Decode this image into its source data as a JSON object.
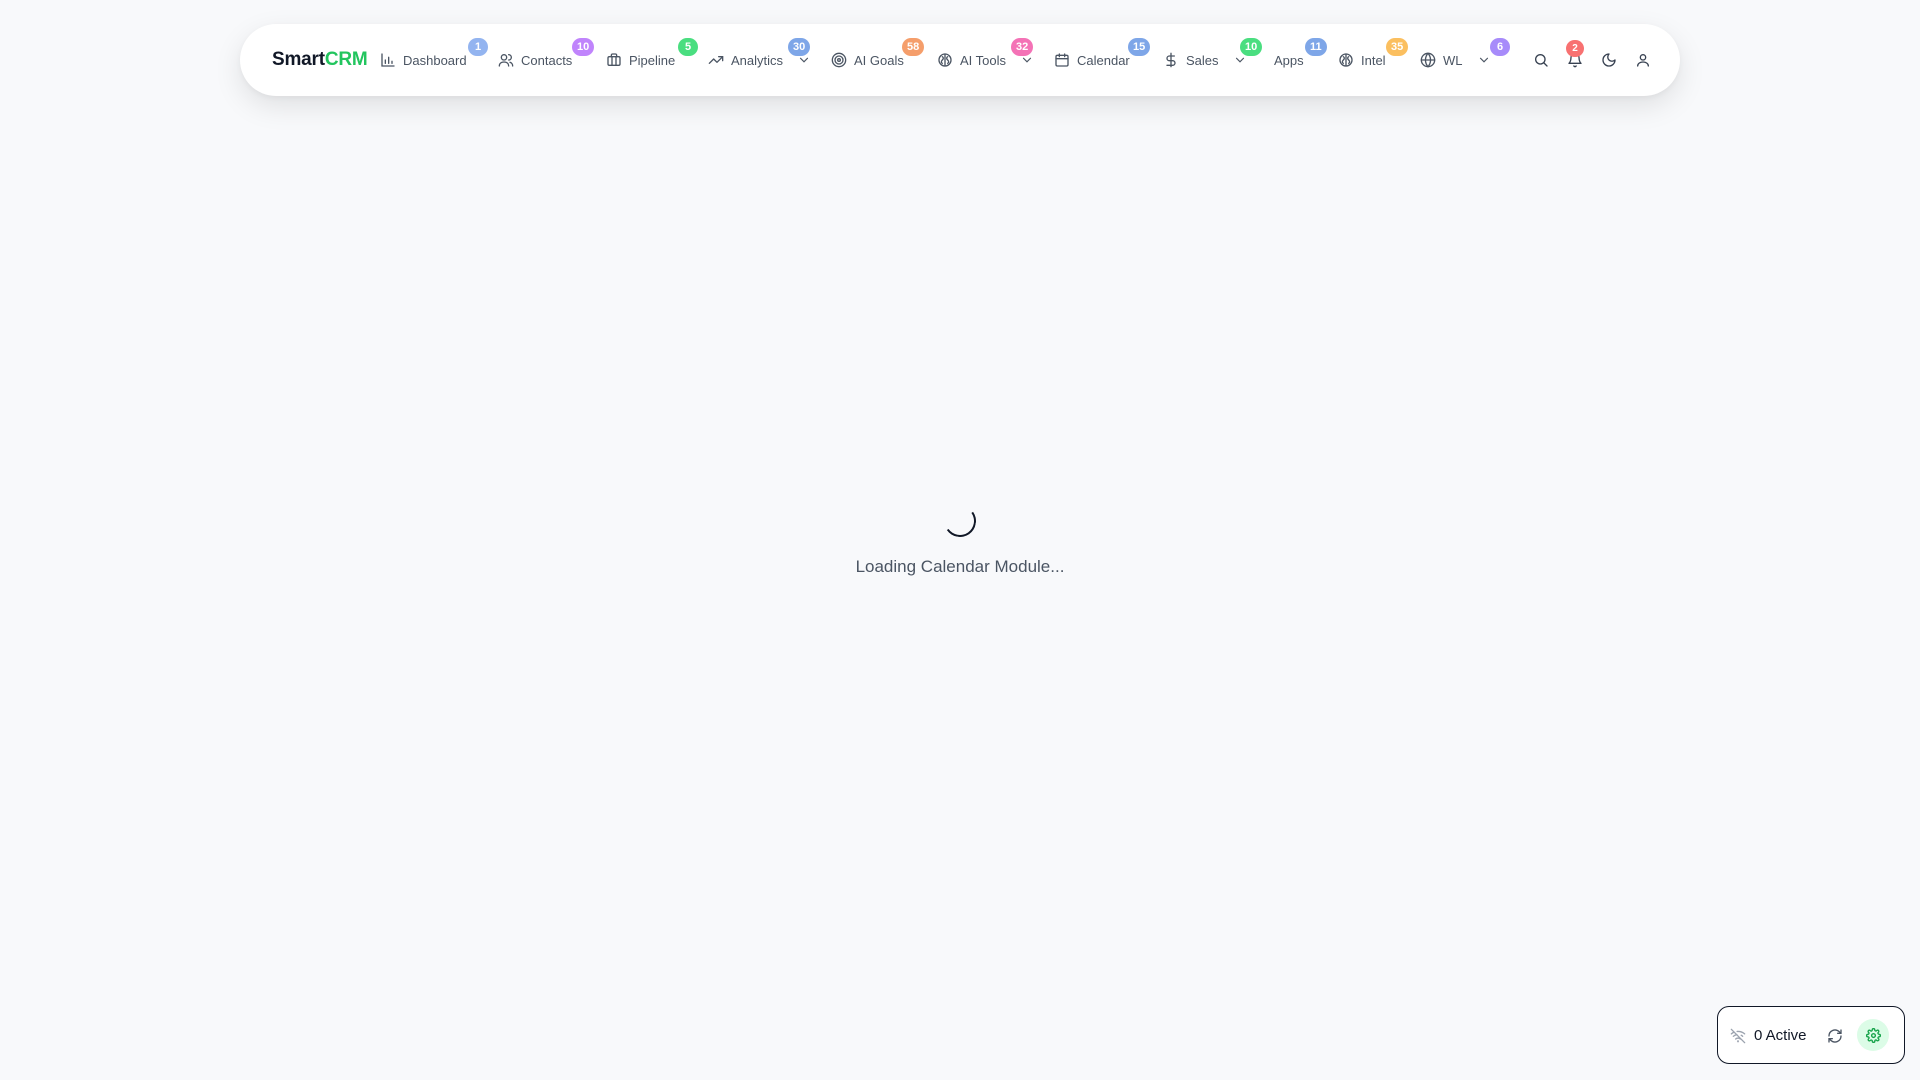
{
  "brand": {
    "part1": "Smart",
    "part2": "CRM",
    "accent": "#22c55e"
  },
  "nav": [
    {
      "id": "dashboard",
      "label": "Dashboard",
      "icon": "bar-chart-icon",
      "badge": "1",
      "badge_color": "#93b4f0",
      "dropdown": false
    },
    {
      "id": "contacts",
      "label": "Contacts",
      "icon": "users-icon",
      "badge": "10",
      "badge_color": "#c084fc",
      "dropdown": false
    },
    {
      "id": "pipeline",
      "label": "Pipeline",
      "icon": "briefcase-icon",
      "badge": "5",
      "badge_color": "#4ade80",
      "dropdown": false
    },
    {
      "id": "analytics",
      "label": "Analytics",
      "icon": "trending-up-icon",
      "badge": "30",
      "badge_color": "#7ea6e8",
      "dropdown": true
    },
    {
      "id": "ai-goals",
      "label": "AI Goals",
      "icon": "target-icon",
      "badge": "58",
      "badge_color": "#f59e6b",
      "dropdown": false
    },
    {
      "id": "ai-tools",
      "label": "AI Tools",
      "icon": "brain-icon",
      "badge": "32",
      "badge_color": "#f472b6",
      "dropdown": true
    },
    {
      "id": "calendar",
      "label": "Calendar",
      "icon": "calendar-icon",
      "badge": "15",
      "badge_color": "#7ea6e8",
      "dropdown": false
    },
    {
      "id": "sales",
      "label": "Sales",
      "icon": "dollar-icon",
      "badge": "10",
      "badge_color": "#4ade80",
      "dropdown": true
    },
    {
      "id": "apps",
      "label": "Apps",
      "icon": "",
      "badge": "11",
      "badge_color": "#7ea6e8",
      "dropdown": false
    },
    {
      "id": "intel",
      "label": "Intel",
      "icon": "brain-icon",
      "badge": "35",
      "badge_color": "#fbbf5f",
      "dropdown": false
    },
    {
      "id": "wl",
      "label": "WL",
      "icon": "globe-icon",
      "badge": "6",
      "badge_color": "#a78bfa",
      "dropdown": true
    }
  ],
  "actions": {
    "search_icon": "search-icon",
    "bell_icon": "bell-icon",
    "notification_count": "2",
    "notification_color": "#f87171",
    "theme_icon": "moon-icon",
    "user_icon": "user-icon"
  },
  "loading": {
    "text": "Loading Calendar Module..."
  },
  "status": {
    "active_text": "0 Active",
    "settings_bg": "#dcfce7",
    "settings_color": "#16a34a"
  }
}
